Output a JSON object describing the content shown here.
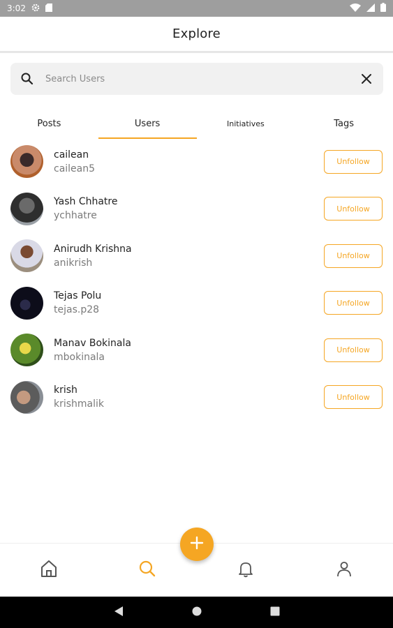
{
  "status_bar": {
    "time": "3:02"
  },
  "header": {
    "title": "Explore"
  },
  "search": {
    "placeholder": "Search Users",
    "value": ""
  },
  "tabs": [
    {
      "label": "Posts",
      "active": false
    },
    {
      "label": "Users",
      "active": true
    },
    {
      "label": "Initiatives",
      "active": false
    },
    {
      "label": "Tags",
      "active": false
    }
  ],
  "users": [
    {
      "name": "cailean",
      "handle": "cailean5",
      "action": "Unfollow"
    },
    {
      "name": "Yash Chhatre",
      "handle": "ychhatre",
      "action": "Unfollow"
    },
    {
      "name": "Anirudh Krishna",
      "handle": "anikrish",
      "action": "Unfollow"
    },
    {
      "name": "Tejas Polu",
      "handle": "tejas.p28",
      "action": "Unfollow"
    },
    {
      "name": "Manav Bokinala",
      "handle": "mbokinala",
      "action": "Unfollow"
    },
    {
      "name": "krish",
      "handle": "krishmalik",
      "action": "Unfollow"
    }
  ],
  "bottom_nav": {
    "items": [
      "home-icon",
      "search-icon",
      "bell-icon",
      "profile-icon"
    ],
    "active": "search-icon",
    "fab_icon": "plus-icon"
  },
  "colors": {
    "accent": "#f5a623",
    "status_bar": "#9e9e9e",
    "search_bg": "#f1f1f1"
  }
}
